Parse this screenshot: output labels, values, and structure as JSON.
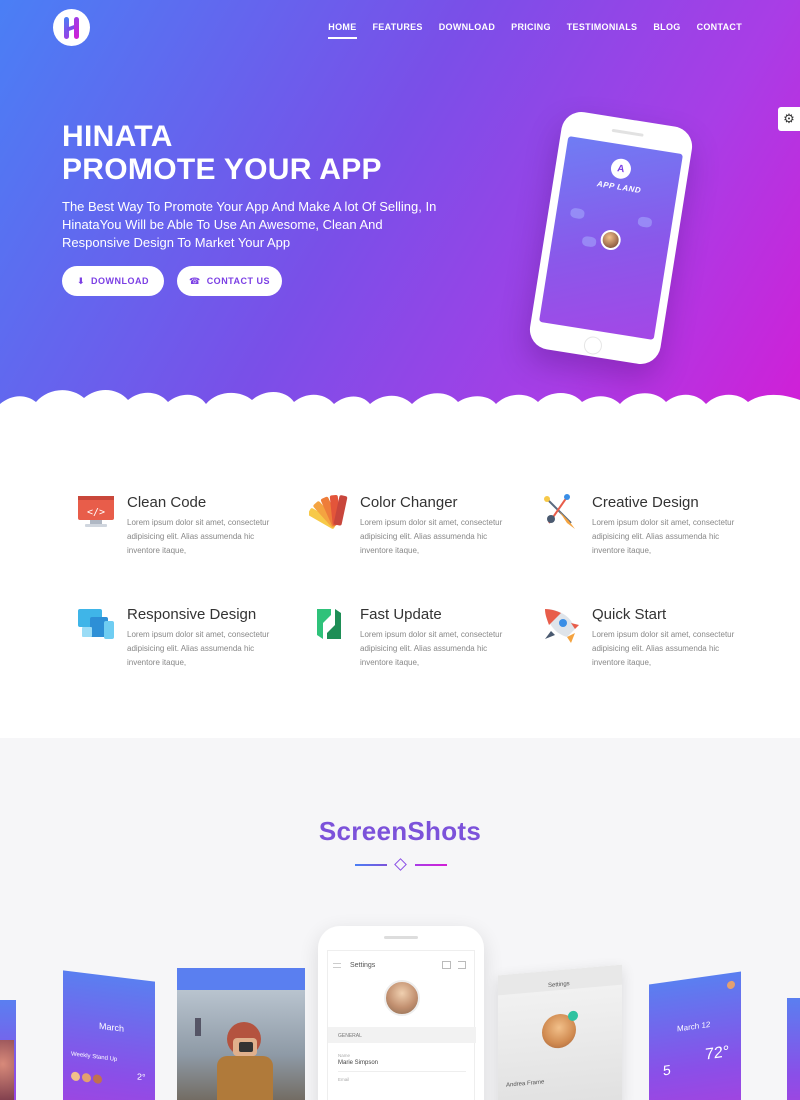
{
  "nav": {
    "items": [
      {
        "label": "HOME",
        "active": true
      },
      {
        "label": "FEATURES",
        "active": false
      },
      {
        "label": "DOWNLOAD",
        "active": false
      },
      {
        "label": "PRICING",
        "active": false
      },
      {
        "label": "TESTIMONIALS",
        "active": false
      },
      {
        "label": "BLOG",
        "active": false
      },
      {
        "label": "CONTACT",
        "active": false
      }
    ]
  },
  "hero": {
    "title_line1": "HINATA",
    "title_line2": "PROMOTE YOUR APP",
    "description": "The Best Way To Promote Your App And Make A lot Of Selling, In HinataYou Will be Able To Use An Awesome, Clean And Responsive Design To Market Your App",
    "download_label": "DOWNLOAD",
    "contact_label": "CONTACT US",
    "phone_app_name": "APP LAND"
  },
  "features": [
    {
      "title": "Clean Code",
      "text": "Lorem ipsum dolor sit amet, consectetur adipisicing elit. Alias assumenda hic inventore itaque,",
      "icon": "code-monitor-icon"
    },
    {
      "title": "Color Changer",
      "text": "Lorem ipsum dolor sit amet, consectetur adipisicing elit. Alias assumenda hic inventore itaque,",
      "icon": "color-palette-icon"
    },
    {
      "title": "Creative Design",
      "text": "Lorem ipsum dolor sit amet, consectetur adipisicing elit. Alias assumenda hic inventore itaque,",
      "icon": "pen-tool-icon"
    },
    {
      "title": "Responsive Design",
      "text": "Lorem ipsum dolor sit amet, consectetur adipisicing elit. Alias assumenda hic inventore itaque,",
      "icon": "devices-icon"
    },
    {
      "title": "Fast Update",
      "text": "Lorem ipsum dolor sit amet, consectetur adipisicing elit. Alias assumenda hic inventore itaque,",
      "icon": "update-arrows-icon"
    },
    {
      "title": "Quick Start",
      "text": "Lorem ipsum dolor sit amet, consectetur adipisicing elit. Alias assumenda hic inventore itaque,",
      "icon": "rocket-icon"
    }
  ],
  "screenshots": {
    "title": "ScreenShots",
    "center": {
      "title": "Settings",
      "section": "GENERAL",
      "name_label": "Name",
      "name_value": "Marie Simpson",
      "email_label": "Email"
    },
    "left": {
      "month": "March",
      "caption": "Weekly Stand Up",
      "temp": "2°"
    },
    "right": {
      "title": "Settings",
      "name": "Andrea Frame"
    },
    "far_right": {
      "date": "March 12",
      "day_num": "5",
      "temp": "72°"
    }
  },
  "colors": {
    "gradient_start": "#4a7ff5",
    "gradient_mid": "#7a4fe8",
    "gradient_end": "#d21ed6",
    "accent": "#7b3fe4"
  }
}
